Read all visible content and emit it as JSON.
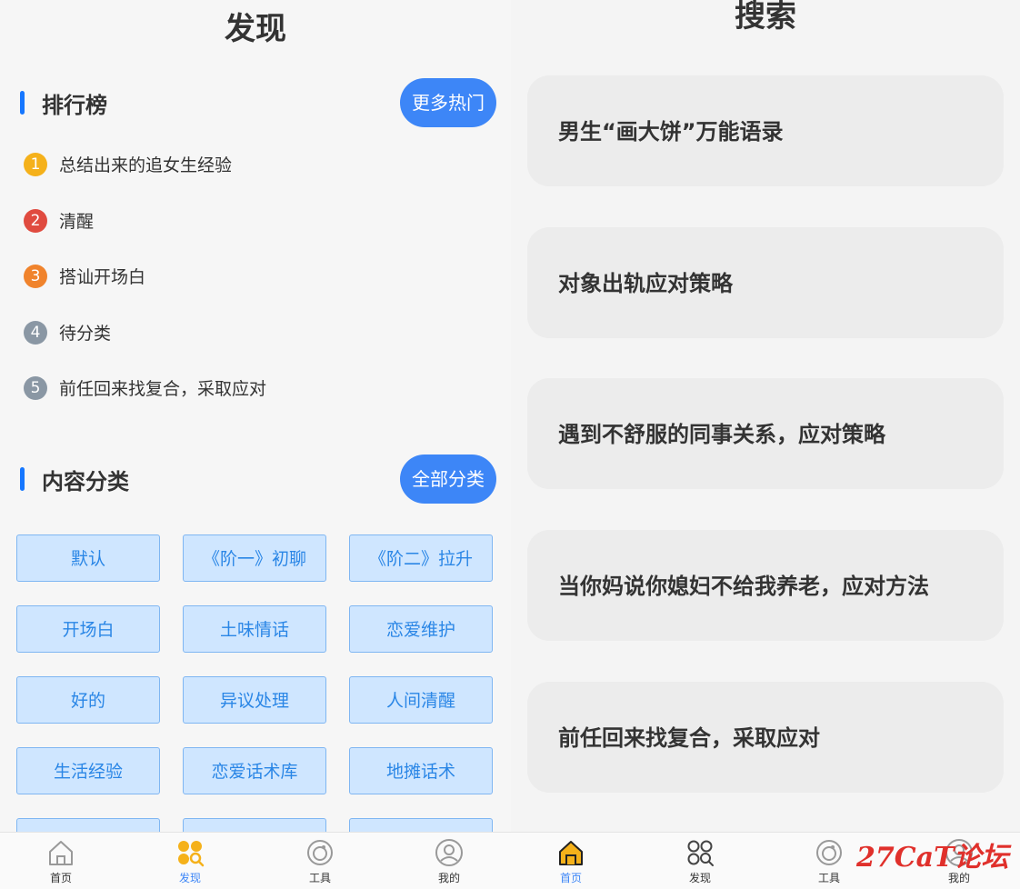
{
  "discover": {
    "title": "发现",
    "ranking": {
      "title": "排行榜",
      "more_label": "更多热门",
      "items": [
        {
          "num": "1",
          "label": "总结出来的追女生经验",
          "color": "#f5b11a"
        },
        {
          "num": "2",
          "label": "清醒",
          "color": "#e04b3f"
        },
        {
          "num": "3",
          "label": "搭讪开场白",
          "color": "#f0832c"
        },
        {
          "num": "4",
          "label": "待分类",
          "color": "#8a97a4"
        },
        {
          "num": "5",
          "label": "前任回来找复合，采取应对",
          "color": "#8a97a4"
        }
      ]
    },
    "categories": {
      "title": "内容分类",
      "all_label": "全部分类",
      "tags": [
        "默认",
        "《阶一》初聊",
        "《阶二》拉升",
        "开场白",
        "土味情话",
        "恋爱维护",
        "好的",
        "异议处理",
        "人间清醒",
        "生活经验",
        "恋爱话术库",
        "地摊话术",
        "",
        "",
        ""
      ]
    },
    "nav": {
      "items": [
        {
          "label": "首页",
          "icon": "home-icon",
          "active": false
        },
        {
          "label": "发现",
          "icon": "discover-icon",
          "active": true
        },
        {
          "label": "工具",
          "icon": "tool-icon",
          "active": false
        },
        {
          "label": "我的",
          "icon": "profile-icon",
          "active": false
        }
      ]
    }
  },
  "search": {
    "title": "搜索",
    "cards": [
      "男生“画大饼”万能语录",
      "对象出轨应对策略",
      "遇到不舒服的同事关系，应对策略",
      "当你妈说你媳妇不给我养老，应对方法",
      "前任回来找复合，采取应对"
    ],
    "nav": {
      "items": [
        {
          "label": "首页",
          "icon": "home-icon",
          "active": true
        },
        {
          "label": "发现",
          "icon": "discover-icon",
          "active": false
        },
        {
          "label": "工具",
          "icon": "tool-icon",
          "active": false
        },
        {
          "label": "我的",
          "icon": "profile-icon",
          "active": false
        }
      ]
    }
  },
  "watermark": "27CaT论坛",
  "colors": {
    "accent": "#3d86f7",
    "tag_bg": "#cfe6ff",
    "tag_text": "#2a86e6"
  }
}
